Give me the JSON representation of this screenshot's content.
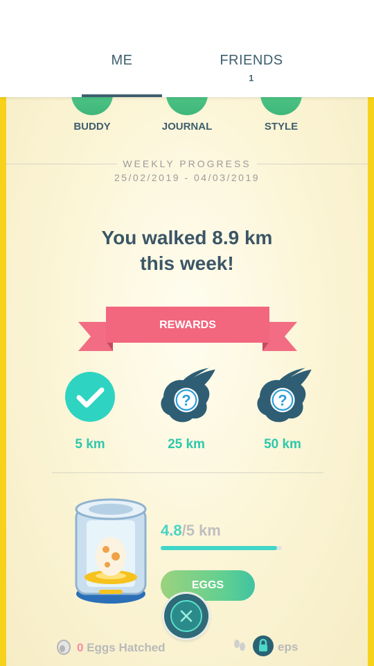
{
  "tabs": [
    {
      "label": "ME",
      "count": ""
    },
    {
      "label": "FRIENDS",
      "count": "1"
    }
  ],
  "nav": {
    "buddy": "BUDDY",
    "journal": "JOURNAL",
    "style": "STYLE"
  },
  "weekly": {
    "title": "WEEKLY PROGRESS",
    "dates": "25/02/2019 - 04/03/2019",
    "walked_line1": "You walked 8.9 km",
    "walked_line2": "this week!"
  },
  "rewards": {
    "banner": "REWARDS",
    "items": [
      {
        "label": "5 km",
        "status": "claimed",
        "icon": "check-icon"
      },
      {
        "label": "25 km",
        "status": "unknown",
        "icon": "mystery-reward-icon"
      },
      {
        "label": "50 km",
        "status": "unknown",
        "icon": "mystery-reward-icon"
      }
    ]
  },
  "incubator": {
    "current": "4.8",
    "total": "/5 km",
    "progress_fraction": 0.96,
    "eggs_button": "EGGS"
  },
  "stats": {
    "eggs_hatched_count": "0",
    "eggs_hatched_label": " Eggs Hatched",
    "steps_label": "eps"
  },
  "colors": {
    "frame": "#f7d21a",
    "teal": "#2fc7ac",
    "ribbon": "#f2667e",
    "text_dark": "#3b5666"
  }
}
